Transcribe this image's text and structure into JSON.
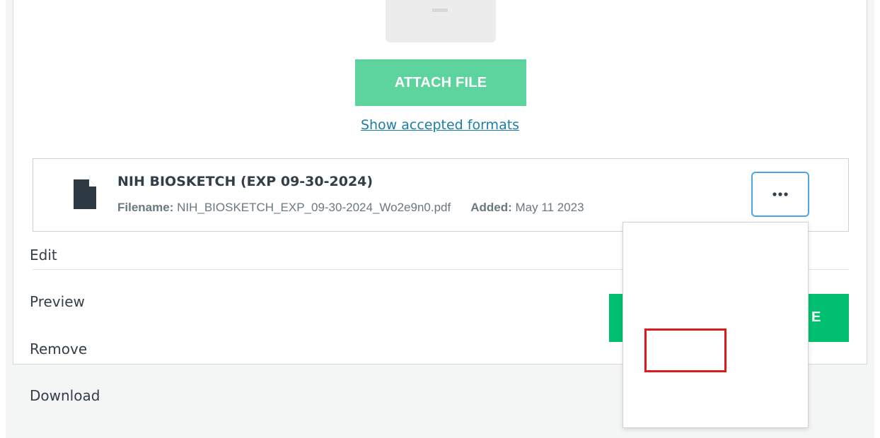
{
  "upload": {
    "attach_label": "ATTACH FILE",
    "formats_link": "Show accepted formats"
  },
  "file": {
    "title": "NIH BIOSKETCH (EXP 09-30-2024)",
    "filename_label": "Filename:",
    "filename": "NIH_BIOSKETCH_EXP_09-30-2024_Wo2e9n0.pdf",
    "added_label": "Added:",
    "added_date": "May 11 2023",
    "more_icon": "more-horizontal-icon"
  },
  "footer": {
    "save_label_visible": "E"
  },
  "menu": {
    "items": [
      "Edit",
      "Preview",
      "Remove",
      "Download"
    ],
    "highlighted": "Remove"
  },
  "colors": {
    "attach_button": "#5dd39e",
    "primary_button": "#00bf6f",
    "link": "#1b7ea8",
    "focus_border": "#4ba4e8",
    "highlight": "#e0181b"
  }
}
